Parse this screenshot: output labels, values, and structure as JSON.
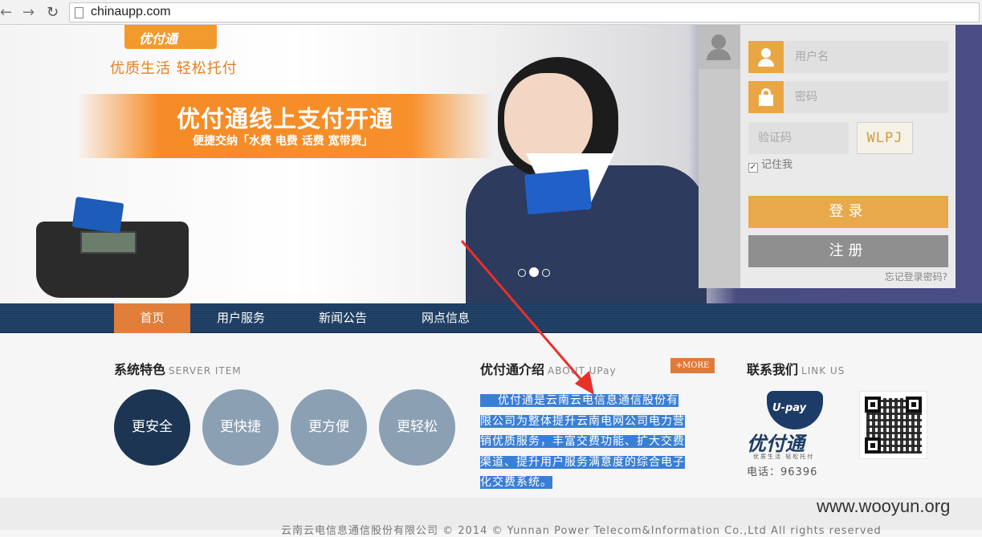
{
  "browser": {
    "url": "chinaupp.com",
    "back_glyph": "←",
    "forward_glyph": "→",
    "reload_glyph": "↻"
  },
  "banner": {
    "logo_text": "优付通",
    "slogan": "优质生活  轻松托付",
    "promo_main": "优付通线上支付开通",
    "promo_sub": "便捷交纳「水费 电费 话费 宽带费」",
    "slide_count": 3,
    "active_slide": 2
  },
  "login": {
    "username_placeholder": "用户名",
    "password_placeholder": "密码",
    "captcha_placeholder": "验证码",
    "captcha_text": "WLPJ",
    "remember_label": "记住我",
    "remember_checked": true,
    "login_button": "登录",
    "register_button": "注册",
    "forgot_link": "忘记登录密码?"
  },
  "nav": {
    "items": [
      {
        "label": "首页",
        "active": true
      },
      {
        "label": "用户服务",
        "active": false
      },
      {
        "label": "新闻公告",
        "active": false
      },
      {
        "label": "网点信息",
        "active": false
      }
    ]
  },
  "features": {
    "title": "系统特色",
    "title_en": "SERVER ITEM",
    "items": [
      "更安全",
      "更快捷",
      "更方便",
      "更轻松"
    ]
  },
  "about": {
    "title": "优付通介绍",
    "title_en": "ABOUT UPay",
    "more_label": "+MORE",
    "lines": [
      "  优付通是云南云电信息通信股份有",
      "限公司为整体提升云南电网公司电力营",
      "销优质服务，丰富交费功能、扩大交费",
      "渠道、提升用户服务满意度的综合电子",
      "化交费系统。"
    ]
  },
  "contact": {
    "title": "联系我们",
    "title_en": "LINK US",
    "logo_en": "U-pay",
    "logo_cn": "优付通",
    "logo_tagline": "优质生活  轻松托付",
    "phone": "电话：96396"
  },
  "footer": {
    "copyright": "云南云电信息通信股份有限公司 © 2014 © Yunnan Power Telecom&Information Co.,Ltd All rights reserved"
  },
  "watermark": "www.wooyun.org",
  "colors": {
    "accent_orange": "#e8a94a",
    "nav_blue": "#1d3d62",
    "nav_active": "#e07e3a",
    "highlight": "#3a7fd6",
    "annotation_red": "#e8302a"
  }
}
